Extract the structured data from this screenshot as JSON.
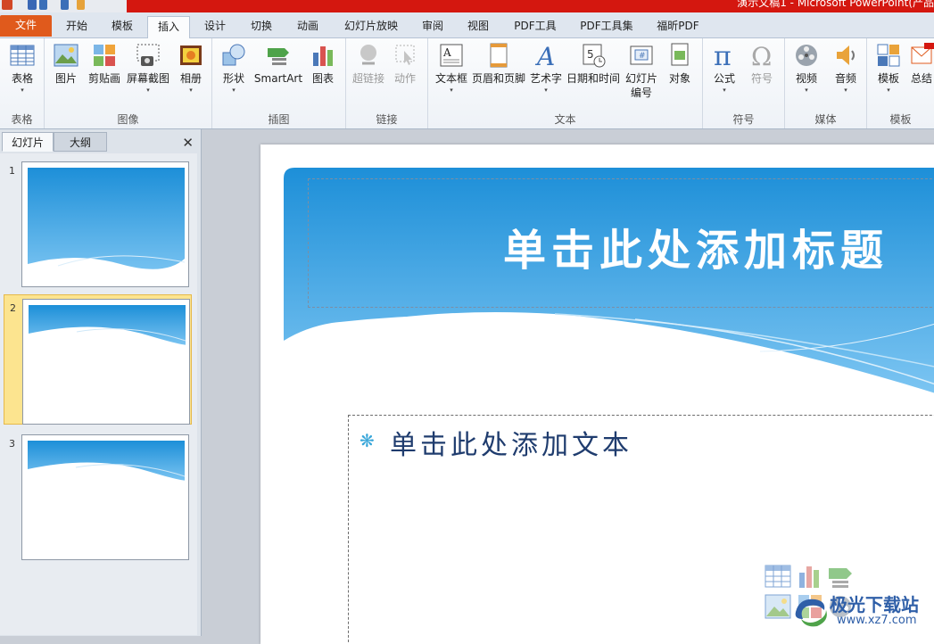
{
  "window": {
    "title": "演示文稿1 - Microsoft PowerPoint(产品"
  },
  "tabs": [
    {
      "label": "文件"
    },
    {
      "label": "开始"
    },
    {
      "label": "模板"
    },
    {
      "label": "插入"
    },
    {
      "label": "设计"
    },
    {
      "label": "切换"
    },
    {
      "label": "动画"
    },
    {
      "label": "幻灯片放映"
    },
    {
      "label": "审阅"
    },
    {
      "label": "视图"
    },
    {
      "label": "PDF工具"
    },
    {
      "label": "PDF工具集"
    },
    {
      "label": "福昕PDF"
    }
  ],
  "active_tab": "插入",
  "ribbon": {
    "groups": {
      "table": "表格",
      "images": "图像",
      "illustrations": "插图",
      "links": "链接",
      "text": "文本",
      "symbols": "符号",
      "media": "媒体",
      "templates": "模板"
    },
    "buttons": {
      "table": "表格",
      "picture": "图片",
      "clipart": "剪贴画",
      "screenshot": "屏幕截图",
      "album": "相册",
      "shapes": "形状",
      "smartart": "SmartArt",
      "chart": "图表",
      "hyperlink": "超链接",
      "action": "动作",
      "textbox": "文本框",
      "header_footer": "页眉和页脚",
      "wordart": "艺术字",
      "datetime": "日期和时间",
      "slide_number_1": "幻灯片",
      "slide_number_2": "编号",
      "object": "对象",
      "equation": "公式",
      "symbol": "符号",
      "video": "视频",
      "audio": "音频",
      "template": "模板",
      "summary": "总结"
    }
  },
  "left_pane": {
    "tabs": [
      "幻灯片",
      "大纲"
    ],
    "close": "✕",
    "slides": [
      {
        "number": "1"
      },
      {
        "number": "2"
      },
      {
        "number": "3"
      }
    ],
    "selected_slide": "2"
  },
  "slide": {
    "title_placeholder": "单击此处添加标题",
    "body_bullet": "❋",
    "body_placeholder": "单击此处添加文本"
  },
  "watermark": {
    "brand": "极光下载站",
    "url": "www.xz7.com"
  },
  "colors": {
    "accent": "#d4170f",
    "file_tab": "#e05a1c",
    "slide_blue": "#1d8fd8",
    "selection": "#fce48f"
  }
}
